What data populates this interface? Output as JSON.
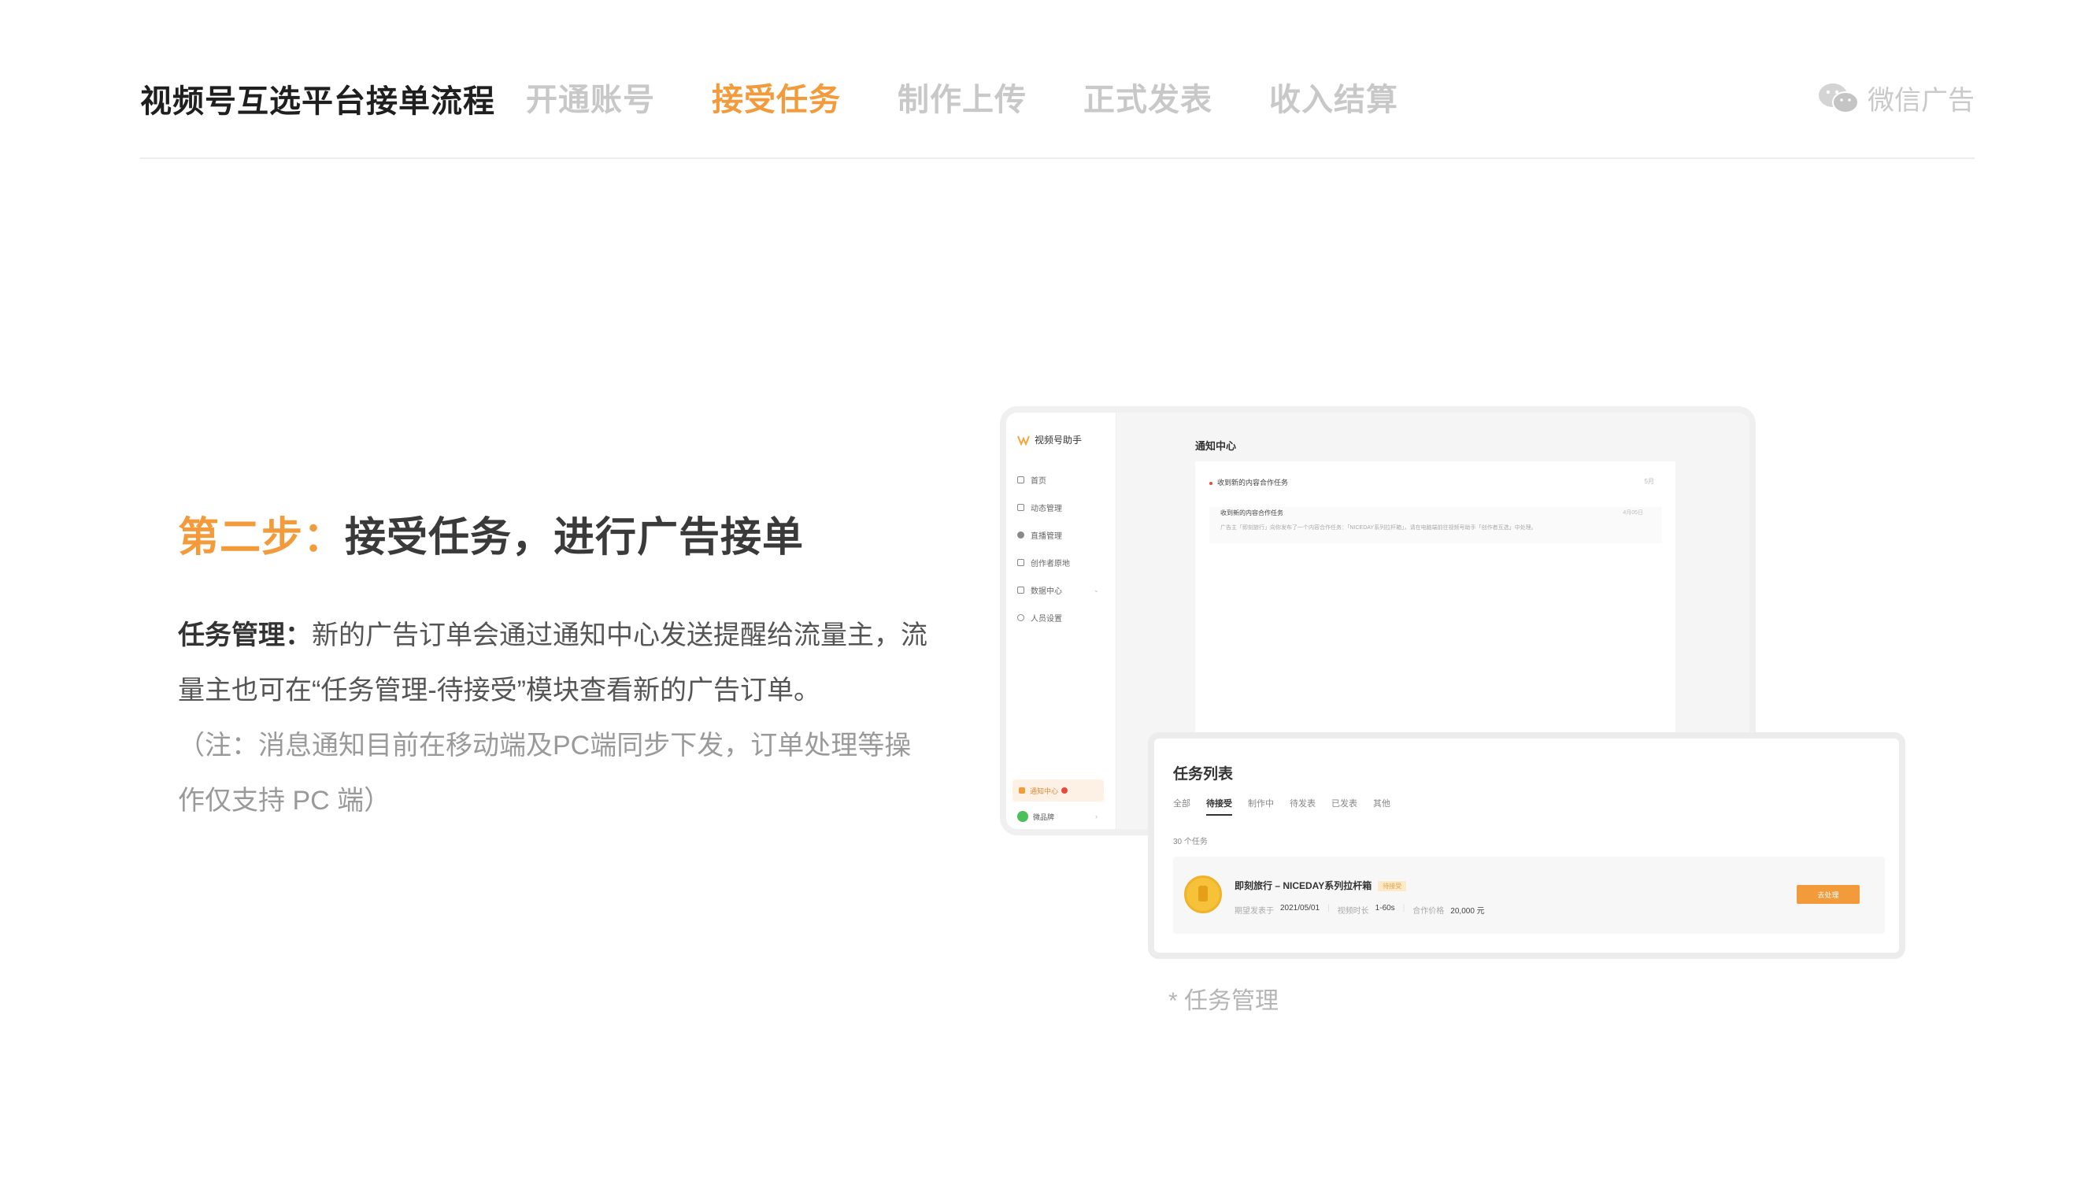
{
  "header": {
    "title": "视频号互选平台接单流程",
    "steps": [
      "开通账号",
      "接受任务",
      "制作上传",
      "正式发表",
      "收入结算"
    ],
    "active_step_index": 1,
    "brand": "微信广告"
  },
  "section": {
    "step_label": "第二步：",
    "title": "接受任务，进行广告接单",
    "desc_strong": "任务管理：",
    "desc_text": "新的广告订单会通过通知中心发送提醒给流量主，流量主也可在“任务管理-待接受”模块查看新的广告订单。",
    "note": "（注：消息通知目前在移动端及PC端同步下发，订单处理等操作仅支持 PC 端）"
  },
  "back_window": {
    "app_name": "视频号助手",
    "sidebar_items": [
      "首页",
      "动态管理",
      "直播管理",
      "创作者原地",
      "数据中心",
      "人员设置"
    ],
    "notify_label": "通知中心",
    "account_label": "微品牌",
    "main_title": "通知中心",
    "notice_title": "收到新的内容合作任务",
    "notice_title_right": "5月",
    "notice_sub_title": "收到新的内容合作任务",
    "notice_sub_right": "4月05日",
    "notice_sub_body": "广告主「即刻旅行」向你发布了一个内容合作任务：「NICEDAY系列拉杆箱」，请在电脑端前往视频号助手「创作者互选」中处理。"
  },
  "task_window": {
    "title": "任务列表",
    "tabs": [
      "全部",
      "待接受",
      "制作中",
      "待发表",
      "已发表",
      "其他"
    ],
    "active_tab_index": 1,
    "count": "30 个任务",
    "task": {
      "name": "即刻旅行 – NICEDAY系列拉杆箱",
      "badge": "待接受",
      "publish_label": "期望发表于",
      "publish_date": "2021/05/01",
      "duration_label": "视频时长",
      "duration": "1-60s",
      "price_label": "合作价格",
      "price": "20,000 元",
      "action": "去处理"
    }
  },
  "caption": "* 任务管理",
  "colors": {
    "accent": "#f39a3b",
    "inactive_step": "#c8c8c8",
    "title": "#1f1f1f"
  }
}
